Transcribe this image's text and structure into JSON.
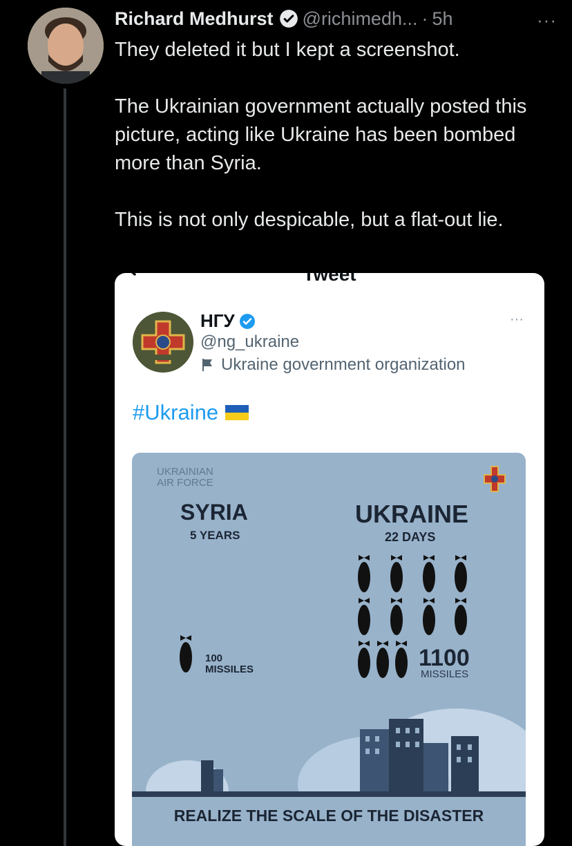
{
  "tweet": {
    "author_name": "Richard Medhurst",
    "handle": "@richimedh...",
    "separator": "·",
    "time": "5h",
    "more": "···",
    "paragraphs": [
      "They deleted it but I kept a screenshot.",
      "The Ukrainian government actually posted this picture, acting like Ukraine has been bombed more than Syria.",
      "This is not only despicable, but a flat-out lie."
    ]
  },
  "screenshot": {
    "title": "Tweet",
    "author_name": "НГУ",
    "handle": "@ng_ukraine",
    "org_label": "Ukraine government organization",
    "hashtag": "#Ukraine",
    "more": "···",
    "infographic": {
      "corner_label_1": "UKRAINIAN",
      "corner_label_2": "AIR FORCE",
      "left_title": "SYRIA",
      "left_sub": "5 YEARS",
      "left_count": "100",
      "left_count_label": "MISSILES",
      "right_title": "UKRAINE",
      "right_sub": "22 DAYS",
      "right_count": "1100",
      "right_count_label": "MISSILES",
      "footer": "REALIZE THE SCALE OF THE DISASTER"
    }
  },
  "colors": {
    "background": "#000000",
    "text": "#e7e9ea",
    "muted": "#8b8f94",
    "link": "#1d9bf0",
    "verified": "#1d9bf0",
    "infographic_bg": "#98b2ca",
    "infographic_ink": "#1b2533"
  },
  "icons": [
    "verified-badge-icon",
    "more-icon",
    "back-arrow-icon",
    "flag-icon",
    "ukraine-flag-icon",
    "ngu-emblem-icon",
    "missile-icon"
  ]
}
